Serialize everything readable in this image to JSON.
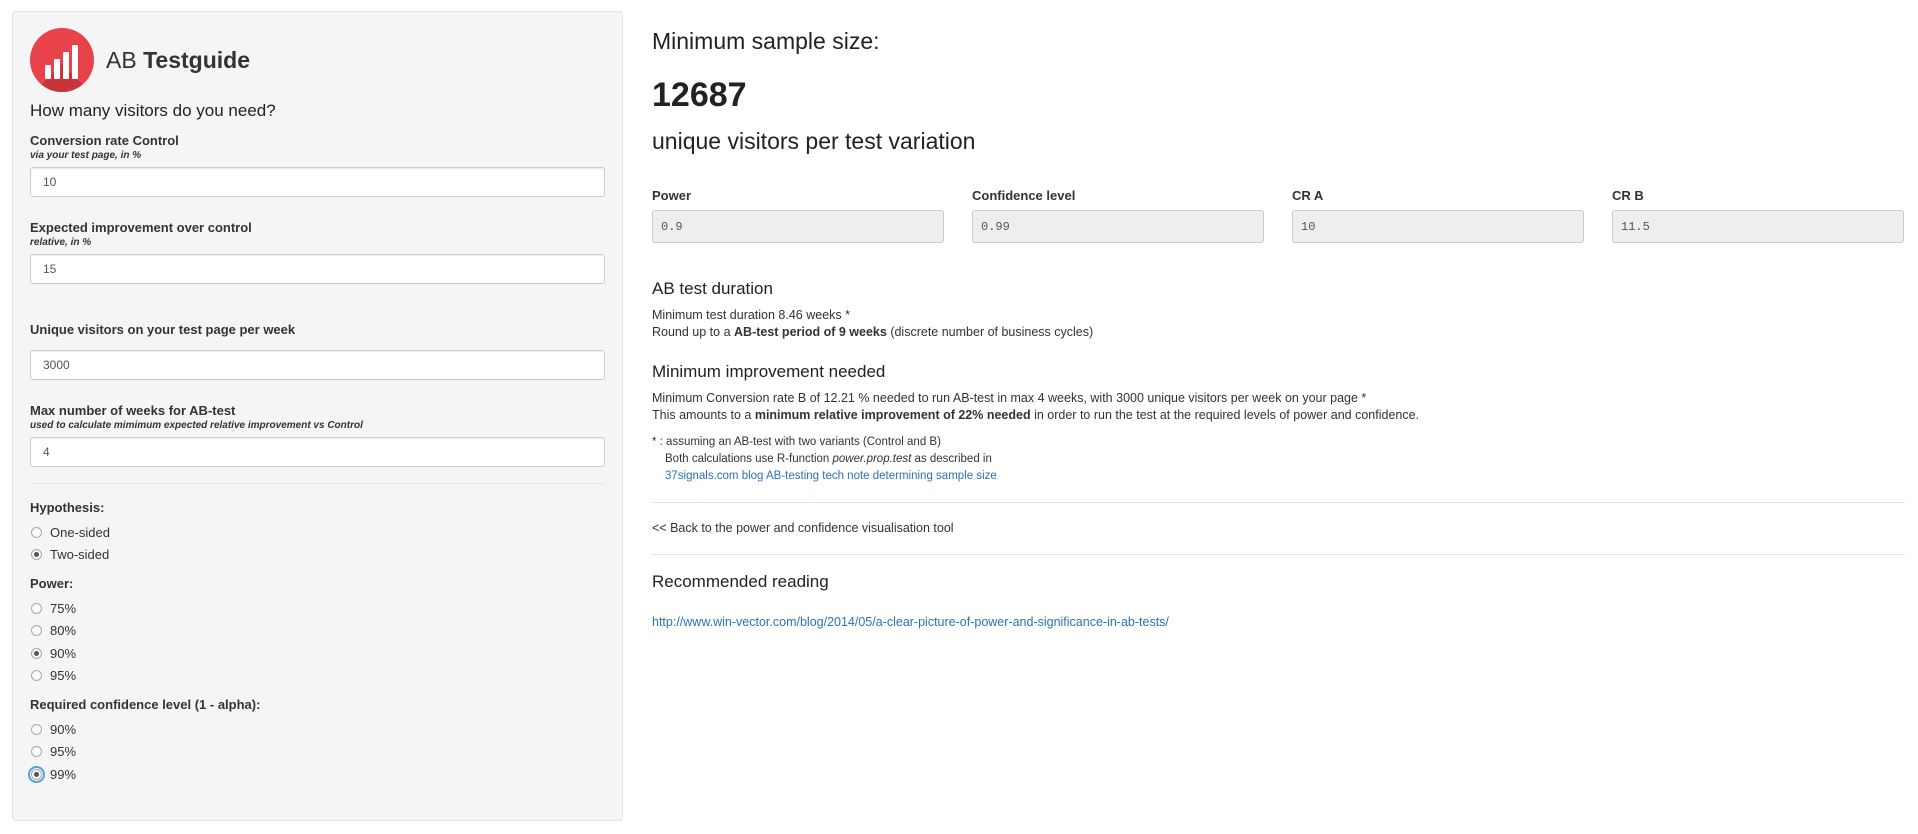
{
  "brand": {
    "prefix": "AB",
    "name": "Testguide",
    "logo_color": "#e8434a"
  },
  "sidebar": {
    "heading": "How many visitors do you need?",
    "conversion": {
      "label": "Conversion rate Control",
      "hint": "via your test page, in %",
      "value": "10"
    },
    "improvement": {
      "label": "Expected improvement over control",
      "hint": "relative, in %",
      "value": "15"
    },
    "visitors": {
      "label": "Unique visitors on your test page per week",
      "value": "3000"
    },
    "weeks": {
      "label": "Max number of weeks for AB-test",
      "hint": "used to calculate mimimum expected relative improvement vs Control",
      "value": "4"
    },
    "hypothesis": {
      "title": "Hypothesis:",
      "options": [
        "One-sided",
        "Two-sided"
      ],
      "selected": "Two-sided"
    },
    "power": {
      "title": "Power:",
      "options": [
        "75%",
        "80%",
        "90%",
        "95%"
      ],
      "selected": "90%"
    },
    "confidence": {
      "title": "Required confidence level (1 - alpha):",
      "options": [
        "90%",
        "95%",
        "99%"
      ],
      "selected": "99%"
    }
  },
  "main": {
    "title": "Minimum sample size:",
    "sample_size": "12687",
    "subtitle": "unique visitors per test variation",
    "stats": [
      {
        "label": "Power",
        "value": "0.9"
      },
      {
        "label": "Confidence level",
        "value": "0.99"
      },
      {
        "label": "CR A",
        "value": "10"
      },
      {
        "label": "CR B",
        "value": "11.5"
      }
    ],
    "duration": {
      "title": "AB test duration",
      "line1": "Minimum test duration 8.46 weeks *",
      "line2_pre": "Round up to a ",
      "line2_bold": "AB-test period of 9 weeks",
      "line2_post": " (discrete number of business cycles)"
    },
    "improvement": {
      "title": "Minimum improvement needed",
      "line1": "Minimum Conversion rate B of 12.21 % needed to run AB-test in max 4 weeks, with 3000 unique visitors per week on your page *",
      "line2_pre": "This amounts to a ",
      "line2_bold": "minimum relative improvement of 22% needed",
      "line2_post": " in order to run the test at the required levels of power and confidence."
    },
    "footnote": {
      "line1": "* : assuming an AB-test with two variants (Control and B)",
      "line2_pre": "Both calculations use R-function ",
      "line2_em": "power.prop.test",
      "line2_post": " as described in",
      "link": "37signals.com blog AB-testing tech note determining sample size"
    },
    "back_link": "<< Back to the power and confidence visualisation tool",
    "reading": {
      "title": "Recommended reading",
      "link": "http://www.win-vector.com/blog/2014/05/a-clear-picture-of-power-and-significance-in-ab-tests/"
    }
  }
}
